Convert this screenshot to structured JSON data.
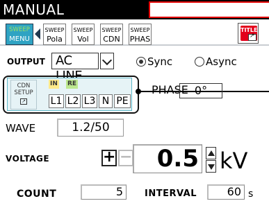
{
  "title_bar": {
    "mode": "MANUAL",
    "title_field": ""
  },
  "toolbar": {
    "sweep_menu": {
      "line1": "SWEEP",
      "line2": "MENU"
    },
    "sweep_buttons": [
      {
        "line1": "SWEEP",
        "line2": "Pola"
      },
      {
        "line1": "SWEEP",
        "line2": "Vol"
      },
      {
        "line1": "SWEEP",
        "line2": "CDN"
      },
      {
        "line1": "SWEEP",
        "line2": "PHAS"
      }
    ],
    "title_button": "TITLE"
  },
  "output": {
    "label": "OUTPUT",
    "value": "AC LINE",
    "sync_label": "Sync",
    "async_label": "Async",
    "selected": "Sync"
  },
  "cdn": {
    "setup_line1": "CDN",
    "setup_line2": "SETUP",
    "tag_in": "IN",
    "tag_re": "RE",
    "lines": [
      "L1",
      "L2",
      "L3",
      "N",
      "PE"
    ]
  },
  "phase": {
    "label": "PHASE",
    "value": "0°"
  },
  "wave": {
    "label": "WAVE",
    "value": "1.2/50"
  },
  "voltage": {
    "label": "VOLTAGE",
    "plus": "+",
    "minus": "−",
    "value": "0.5",
    "unit": "kV"
  },
  "count": {
    "label": "COUNT",
    "value": "5"
  },
  "interval": {
    "label": "INTERVAL",
    "value": "60",
    "unit": "s"
  },
  "colors": {
    "accent": "#2fa3c3",
    "title_border": "#e30000",
    "cdn_panel": "#e6f3f6",
    "title_button": "#e3001b"
  }
}
